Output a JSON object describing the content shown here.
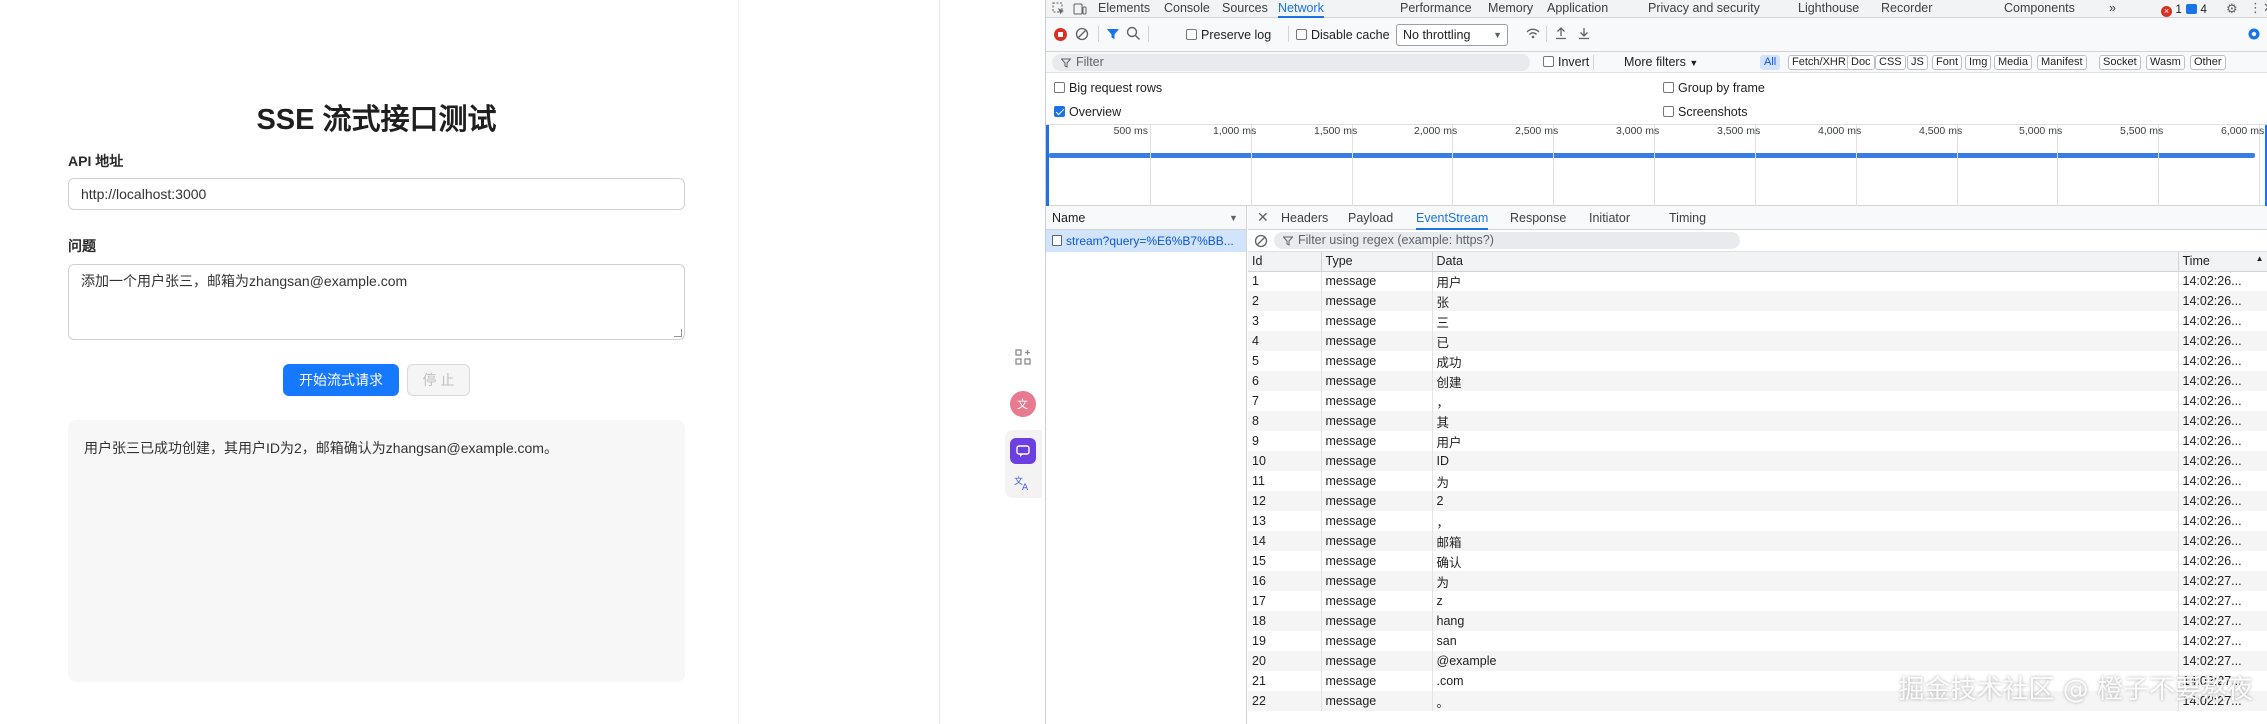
{
  "app": {
    "title": "SSE 流式接口测试",
    "api_label": "API 地址",
    "api_value": "http://localhost:3000",
    "question_label": "问题",
    "question_value": "添加一个用户张三，邮箱为zhangsan@example.com",
    "start_button": "开始流式请求",
    "stop_button": "停 止",
    "result_text": "用户张三已成功创建，其用户ID为2，邮箱确认为zhangsan@example.com。"
  },
  "devtools": {
    "tabs": [
      "Elements",
      "Console",
      "Sources",
      "Network",
      "Performance",
      "Memory",
      "Application",
      "Privacy and security",
      "Lighthouse",
      "Recorder",
      "Components"
    ],
    "active_tab": "Network",
    "error_count": "1",
    "message_count": "4",
    "toolbar": {
      "preserve_log": "Preserve log",
      "disable_cache": "Disable cache",
      "throttling": "No throttling"
    },
    "filter": {
      "placeholder": "Filter",
      "invert": "Invert",
      "more_filters": "More filters",
      "chips": [
        "All",
        "Fetch/XHR",
        "Doc",
        "CSS",
        "JS",
        "Font",
        "Img",
        "Media",
        "Manifest",
        "Socket",
        "Wasm",
        "Other"
      ],
      "active_chip": "All"
    },
    "options": {
      "big_request_rows": "Big request rows",
      "group_by_frame": "Group by frame",
      "overview": "Overview",
      "screenshots": "Screenshots"
    },
    "timeline_ticks": [
      "500 ms",
      "1,000 ms",
      "1,500 ms",
      "2,000 ms",
      "2,500 ms",
      "3,000 ms",
      "3,500 ms",
      "4,000 ms",
      "4,500 ms",
      "5,000 ms",
      "5,500 ms",
      "6,000 ms"
    ],
    "name_header": "Name",
    "request_name": "stream?query=%E6%B7%BB...",
    "detail_tabs": [
      "Headers",
      "Payload",
      "EventStream",
      "Response",
      "Initiator",
      "Timing"
    ],
    "active_detail_tab": "EventStream",
    "event_filter_placeholder": "Filter using regex (example: https?)",
    "columns": [
      "Id",
      "Type",
      "Data",
      "Time"
    ],
    "events": [
      {
        "id": "1",
        "type": "message",
        "data": "用户",
        "time": "14:02:26..."
      },
      {
        "id": "2",
        "type": "message",
        "data": "张",
        "time": "14:02:26..."
      },
      {
        "id": "3",
        "type": "message",
        "data": "三",
        "time": "14:02:26..."
      },
      {
        "id": "4",
        "type": "message",
        "data": "已",
        "time": "14:02:26..."
      },
      {
        "id": "5",
        "type": "message",
        "data": "成功",
        "time": "14:02:26..."
      },
      {
        "id": "6",
        "type": "message",
        "data": "创建",
        "time": "14:02:26..."
      },
      {
        "id": "7",
        "type": "message",
        "data": "，",
        "time": "14:02:26..."
      },
      {
        "id": "8",
        "type": "message",
        "data": "其",
        "time": "14:02:26..."
      },
      {
        "id": "9",
        "type": "message",
        "data": "用户",
        "time": "14:02:26..."
      },
      {
        "id": "10",
        "type": "message",
        "data": "ID",
        "time": "14:02:26..."
      },
      {
        "id": "11",
        "type": "message",
        "data": "为",
        "time": "14:02:26..."
      },
      {
        "id": "12",
        "type": "message",
        "data": "2",
        "time": "14:02:26..."
      },
      {
        "id": "13",
        "type": "message",
        "data": "，",
        "time": "14:02:26..."
      },
      {
        "id": "14",
        "type": "message",
        "data": "邮箱",
        "time": "14:02:26..."
      },
      {
        "id": "15",
        "type": "message",
        "data": "确认",
        "time": "14:02:26..."
      },
      {
        "id": "16",
        "type": "message",
        "data": "为",
        "time": "14:02:27..."
      },
      {
        "id": "17",
        "type": "message",
        "data": "z",
        "time": "14:02:27..."
      },
      {
        "id": "18",
        "type": "message",
        "data": "hang",
        "time": "14:02:27..."
      },
      {
        "id": "19",
        "type": "message",
        "data": "san",
        "time": "14:02:27..."
      },
      {
        "id": "20",
        "type": "message",
        "data": "@example",
        "time": "14:02:27..."
      },
      {
        "id": "21",
        "type": "message",
        "data": ".com",
        "time": "14:02:27..."
      },
      {
        "id": "22",
        "type": "message",
        "data": "。",
        "time": "14:02:27..."
      }
    ]
  },
  "watermark": "掘金技术社区 @ 橙子不要熬夜",
  "colors": {
    "primary": "#1677ff",
    "devtools_accent": "#1a73e8",
    "overview_bar": "#3b7de6",
    "error": "#d93025"
  }
}
